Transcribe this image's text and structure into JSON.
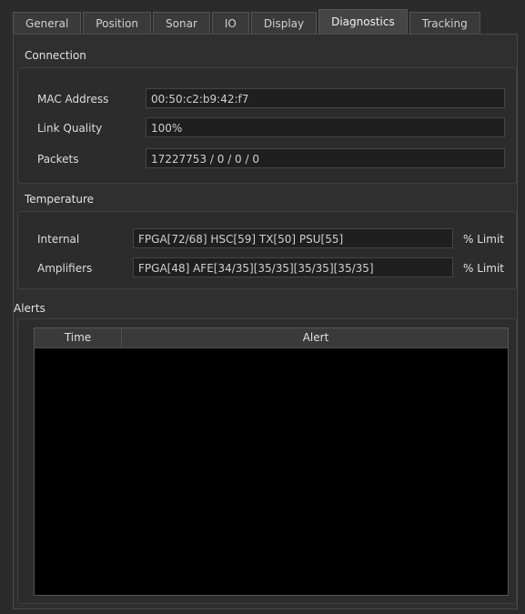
{
  "tabs": [
    "General",
    "Position",
    "Sonar",
    "IO",
    "Display",
    "Diagnostics",
    "Tracking"
  ],
  "active_tab": "Diagnostics",
  "connection": {
    "title": "Connection",
    "mac_label": "MAC Address",
    "mac_value": "00:50:c2:b9:42:f7",
    "link_label": "Link Quality",
    "link_value": "100%",
    "packets_label": "Packets",
    "packets_value": "17227753 / 0 / 0 / 0"
  },
  "temperature": {
    "title": "Temperature",
    "internal_label": "Internal",
    "internal_value": "FPGA[72/68] HSC[59] TX[50] PSU[55]",
    "internal_suffix": "% Limit",
    "amplifiers_label": "Amplifiers",
    "amplifiers_value": "FPGA[48] AFE[34/35][35/35][35/35][35/35]",
    "amplifiers_suffix": "% Limit"
  },
  "alerts": {
    "title": "Alerts",
    "columns": [
      "Time",
      "Alert"
    ]
  }
}
